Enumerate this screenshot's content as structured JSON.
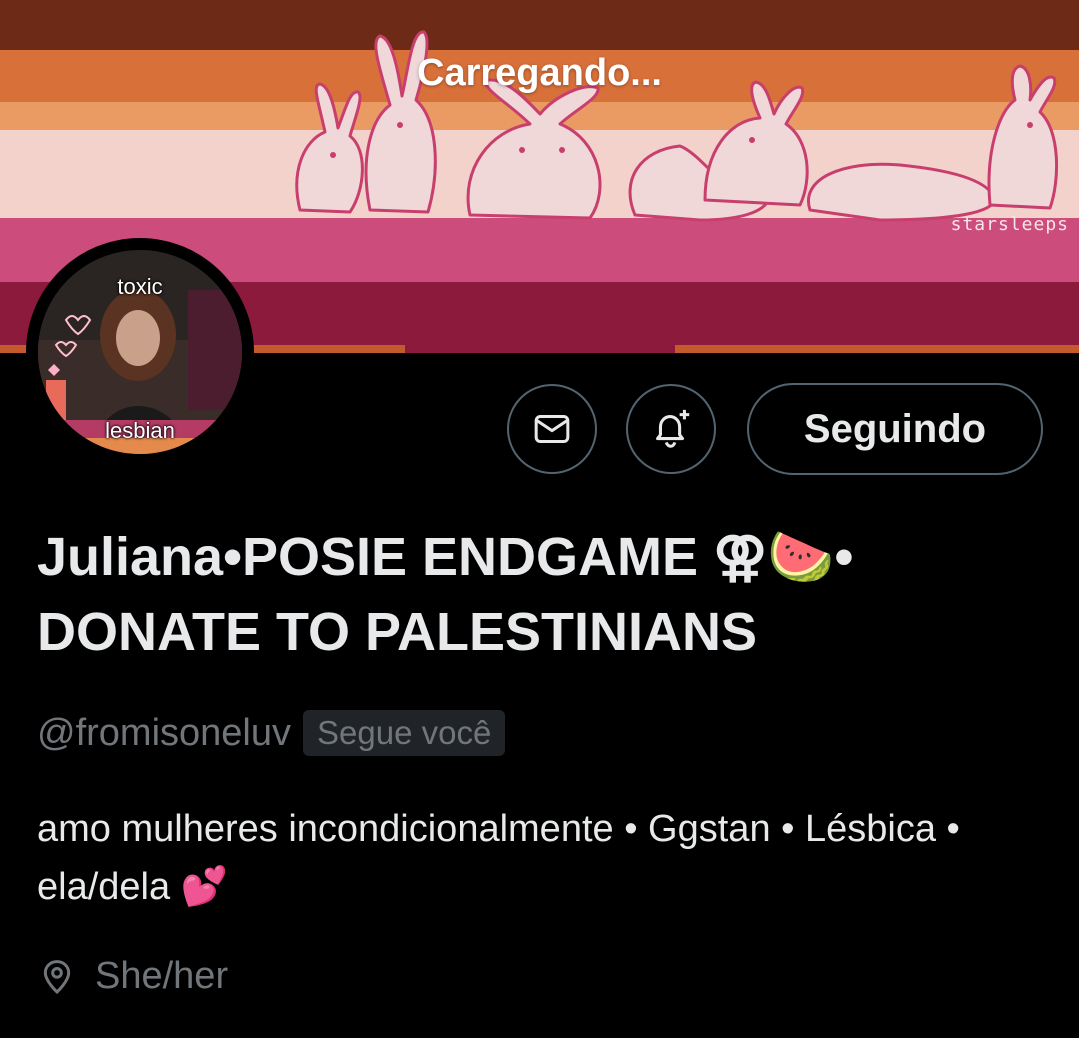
{
  "banner": {
    "loading_text": "Carregando...",
    "watermark": "starsleeps",
    "colors": [
      "#6d2a16",
      "#d8703a",
      "#ea9a63",
      "#f3d2cc",
      "#cc4d7b",
      "#8b1a3d"
    ]
  },
  "avatar": {
    "caption_top": "toxic",
    "caption_bottom": "lesbian"
  },
  "actions": {
    "message_icon": "envelope-icon",
    "notify_icon": "bell-plus-icon",
    "follow_label": "Seguindo"
  },
  "profile": {
    "display_name": "Juliana•POSIE ENDGAME ⚢🍉• DONATE TO PALESTINIANS",
    "handle": "@fromisoneluv",
    "follows_you": "Segue você",
    "bio": "amo mulheres incondicionalmente • Ggstan • Lésbica • ela/dela 💕",
    "location": "She/her",
    "location_icon": "location-pin-icon"
  },
  "colors": {
    "background": "#000000",
    "text_primary": "#e7e9ea",
    "text_secondary": "#71767b",
    "border": "#536471"
  }
}
